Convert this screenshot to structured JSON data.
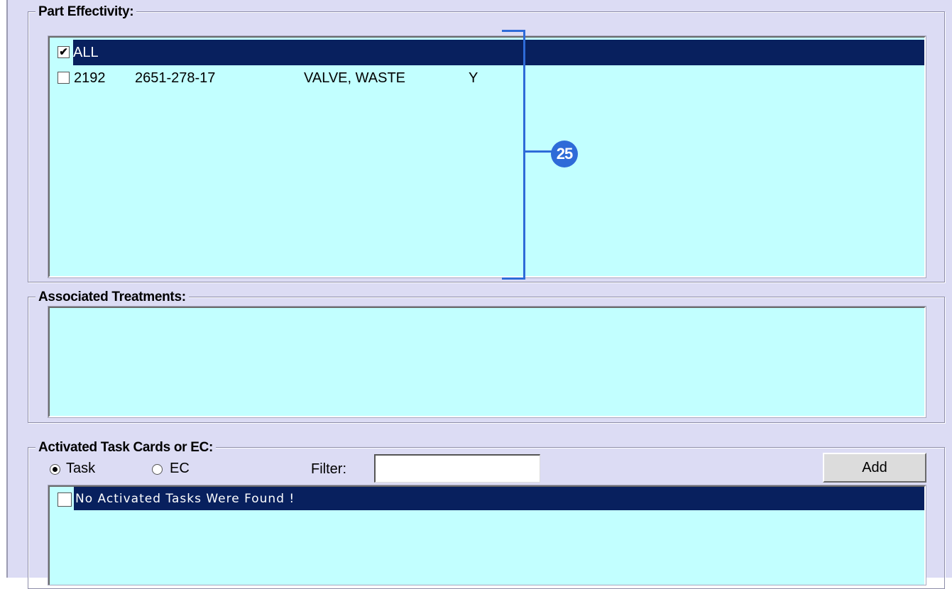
{
  "part_effectivity": {
    "title": "Part Effectivity:",
    "rows": [
      {
        "checked": true,
        "selected": true,
        "col1": "ALL",
        "col2": "",
        "col3": "",
        "col4": ""
      },
      {
        "checked": false,
        "selected": false,
        "col1": "2192",
        "col2": "2651-278-17",
        "col3": "VALVE, WASTE",
        "col4": "Y"
      }
    ]
  },
  "associated_treatments": {
    "title": "Associated Treatments:"
  },
  "activated_tasks": {
    "title": "Activated Task Cards or EC:",
    "radio_task_label": "Task",
    "radio_ec_label": "EC",
    "selected_radio": "Task",
    "filter_label": "Filter:",
    "filter_value": "",
    "add_label": "Add",
    "rows": [
      {
        "checked": false,
        "selected": true,
        "text": "No Activated Tasks Were Found !"
      }
    ]
  },
  "callout": {
    "number": "25",
    "color": "#2e6bd8"
  },
  "colors": {
    "panel_bg": "#dcdcf4",
    "list_bg": "#c2ffff",
    "selection": "#08205e"
  }
}
